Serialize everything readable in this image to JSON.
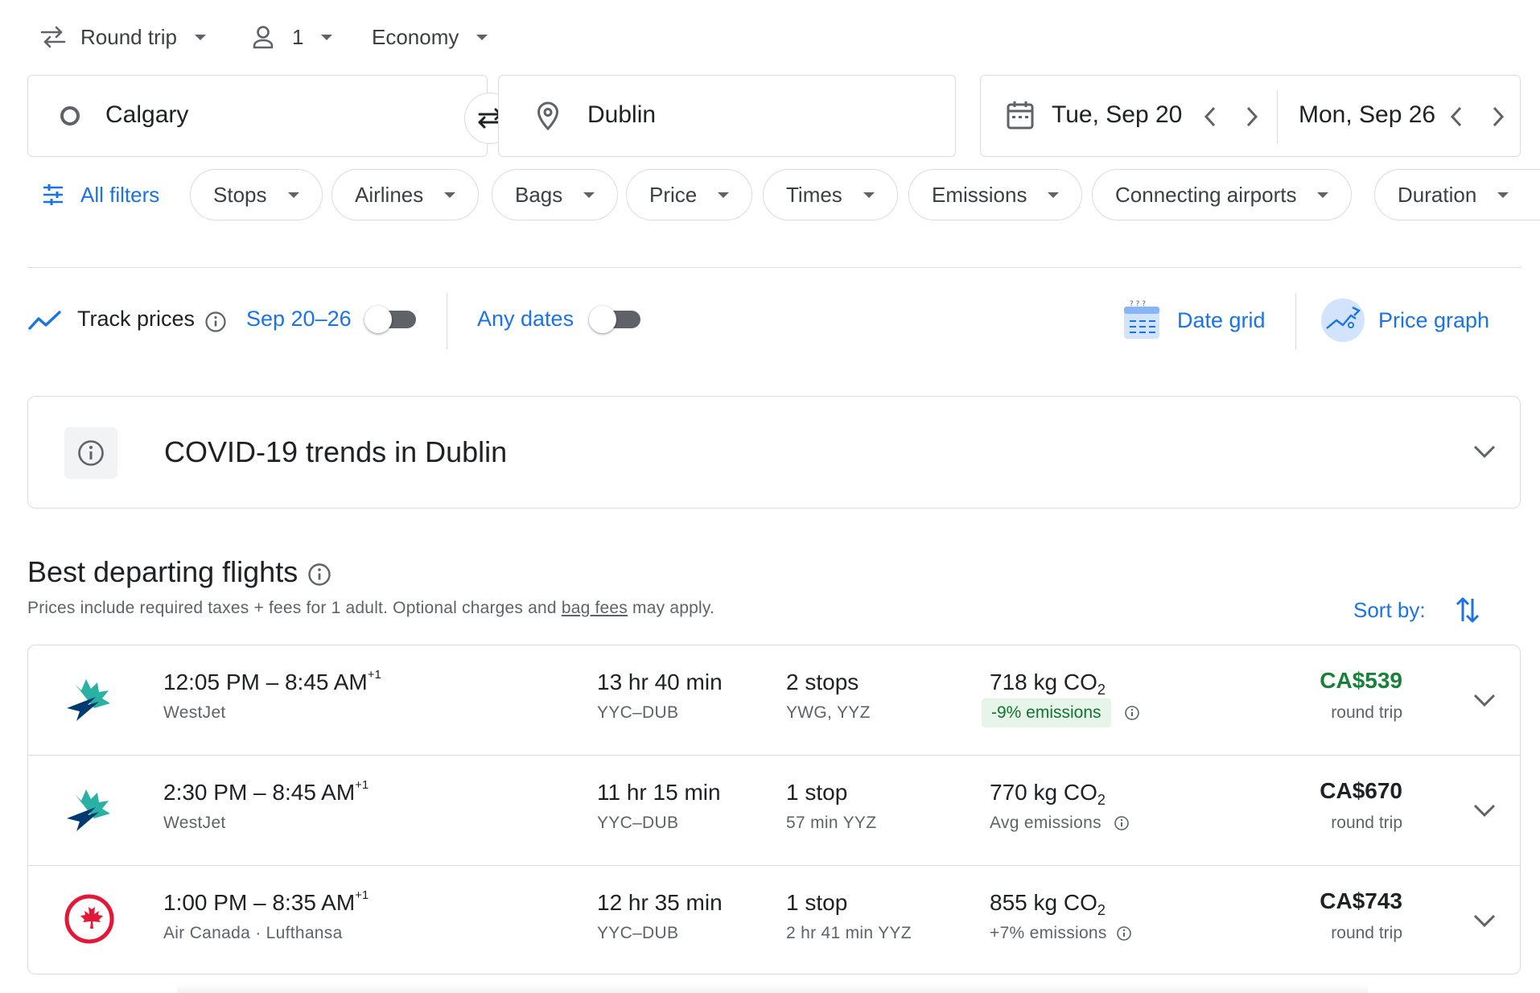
{
  "trip_type": "Round trip",
  "passengers": "1",
  "cabin_class": "Economy",
  "origin": "Calgary",
  "destination": "Dublin",
  "depart_date": "Tue, Sep 20",
  "return_date": "Mon, Sep 26",
  "filters": {
    "all": "All filters",
    "chips": [
      "Stops",
      "Airlines",
      "Bags",
      "Price",
      "Times",
      "Emissions",
      "Connecting airports",
      "Duration"
    ]
  },
  "tracking": {
    "label": "Track prices",
    "range": "Sep 20–26",
    "any_dates": "Any dates",
    "date_grid": "Date grid",
    "price_graph": "Price graph"
  },
  "covid": {
    "title": "COVID-19 trends in Dublin"
  },
  "results": {
    "heading": "Best departing flights",
    "note_pre": "Prices include required taxes + fees for 1 adult. Optional charges and ",
    "note_link": "bag fees",
    "note_post": " may apply.",
    "sort_label": "Sort by:",
    "flights": [
      {
        "times": "12:05 PM – 8:45 AM",
        "day_offset": "+1",
        "airline": "WestJet",
        "duration": "13 hr 40 min",
        "route": "YYC–DUB",
        "stops": "2 stops",
        "stops_detail": "YWG, YYZ",
        "emissions_value": "718 kg CO",
        "emissions_sub": "2",
        "emissions_note": "-9% emissions",
        "price": "CA$539",
        "price_type": "round trip",
        "price_color": "#188038"
      },
      {
        "times": "2:30 PM – 8:45 AM",
        "day_offset": "+1",
        "airline": "WestJet",
        "duration": "11 hr 15 min",
        "route": "YYC–DUB",
        "stops": "1 stop",
        "stops_detail": "57 min YYZ",
        "emissions_value": "770 kg CO",
        "emissions_sub": "2",
        "emissions_note": "Avg emissions",
        "price": "CA$670",
        "price_type": "round trip",
        "price_color": "#202124"
      },
      {
        "times": "1:00 PM – 8:35 AM",
        "day_offset": "+1",
        "airline": "Air Canada · Lufthansa",
        "duration": "12 hr 35 min",
        "route": "YYC–DUB",
        "stops": "1 stop",
        "stops_detail": "2 hr 41 min YYZ",
        "emissions_value": "855 kg CO",
        "emissions_sub": "2",
        "emissions_note": "+7% emissions",
        "price": "CA$743",
        "price_type": "round trip",
        "price_color": "#202124"
      }
    ]
  },
  "icons": {
    "swap": "swap-arrows-icon",
    "passenger": "person-icon",
    "origin": "circle-icon",
    "destination": "location-pin-icon",
    "calendar": "calendar-icon",
    "filters": "tune-icon",
    "track": "trend-line-icon",
    "expand": "chevron-down-icon",
    "sort": "sort-arrows-icon"
  },
  "colors": {
    "accent": "#1a73e8",
    "green": "#188038",
    "badge_bg": "#e6f4ea"
  }
}
